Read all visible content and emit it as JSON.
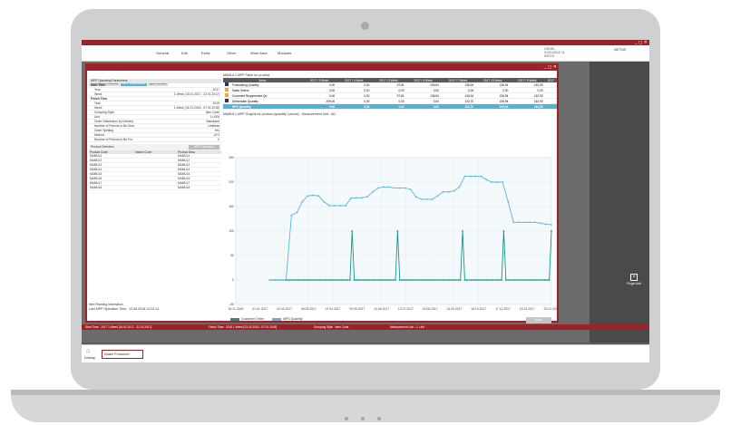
{
  "menu": {
    "items": [
      "General",
      "Edit",
      "Extra",
      "Other",
      "Work Area",
      "Modules"
    ]
  },
  "user": {
    "name": "GENEL",
    "line2": "01/01/2019 11",
    "line3": "INFOS",
    "company": "NETSIS"
  },
  "window": {
    "tabs": [
      "Information Window",
      "MPP Operations",
      "Quit Results"
    ],
    "active_tab": 1
  },
  "params": {
    "title": "MPP Operating Parameters",
    "rows": [
      {
        "k": "Start Time",
        "v": "",
        "sec": true
      },
      {
        "k": "Year",
        "v": "2017"
      },
      {
        "k": "Week",
        "v": "1.Week (16.01.2017 - 22.01.2017)"
      },
      {
        "k": "Finish Time",
        "v": "",
        "sec": true
      },
      {
        "k": "Year",
        "v": "2019"
      },
      {
        "k": "Week",
        "v": "1.Week (31.01.2018 - 07.01.2018)"
      },
      {
        "k": "Grouping Style",
        "v": "Item Code"
      },
      {
        "k": "Unit",
        "v": "1.UOM"
      },
      {
        "k": "Order Distribution by Delivery",
        "v": "Backward"
      },
      {
        "k": "Number of Periods to Be Distr.",
        "v": "Limitless"
      },
      {
        "k": "Order Splitting",
        "v": "Yes"
      },
      {
        "k": "Method",
        "v": "LFO"
      },
      {
        "k": "Number of Periods to Be Fro.",
        "v": "0"
      }
    ]
  },
  "product_selection": {
    "label": "Product Selection",
    "button": "MPP Operating",
    "headers": [
      "Product Code",
      "Variant Code",
      "Product Desc"
    ],
    "rows": [
      [
        "MAMUL1",
        "",
        "MAMUL1"
      ],
      [
        "MAMUL2",
        "",
        "MAMUL2"
      ],
      [
        "MAMUL3",
        "",
        "MAMUL3"
      ],
      [
        "MAMUL4",
        "",
        "MAMUL4"
      ],
      [
        "MAMUL5",
        "",
        "MAMUL5"
      ],
      [
        "MAMUL6",
        "",
        "MAMUL6"
      ],
      [
        "MAMUL7",
        "",
        "MAMUL7"
      ],
      [
        "MAMUL8",
        "",
        "MAMUL8"
      ]
    ]
  },
  "left_footer": {
    "info": "Item Planning Information",
    "last_time": "Last MPP Operation Time : 13.06.2018 14:23:14"
  },
  "table": {
    "title": "MAMUL1 MPP Table for product",
    "headers": [
      "Items",
      "2017 / 3.Week",
      "2017 / 4.Week",
      "2017 / 5.Week",
      "2017 / 6.Week",
      "2017 / 7.Week",
      "2017 / 8.Week",
      "2017 / 9.Week",
      "2017"
    ],
    "rows": [
      {
        "label": "Forecasting Quantity",
        "cb": "c1",
        "vals": [
          "0,00",
          "0,00",
          "97,81",
          "136,94",
          "136,94",
          "136,94",
          "162,90",
          ""
        ]
      },
      {
        "label": "Sales Orders",
        "cb": "c2",
        "vals": [
          "0,00",
          "0,00",
          "0,00",
          "0,00",
          "0,00",
          "0,00",
          "0,00",
          ""
        ]
      },
      {
        "label": "Corrected Requirement Qu",
        "cb": "c2",
        "vals": [
          "0,00",
          "0,00",
          "97,81",
          "136,94",
          "136,94",
          "136,94",
          "162,90",
          ""
        ]
      },
      {
        "label": "Deliverable Quantity",
        "cb": "c1",
        "vals": [
          "299,00",
          "0,00",
          "0,00",
          "0,00",
          "132,70",
          "136,94",
          "162,90",
          ""
        ]
      },
      {
        "label": "MPS Quantity",
        "cb": "c3",
        "vals": [
          "0,00",
          "0,00",
          "0,00",
          "0,00",
          "132,70",
          "136,94",
          "162,90",
          ""
        ],
        "hl": true
      }
    ]
  },
  "chart_title": "MAMUL1 MPP Graphs for product (quantity / period) - Measurement Unit : AD",
  "chart_data": {
    "type": "line",
    "ylim": [
      -50,
      250
    ],
    "yticks": [
      250,
      200,
      150,
      100,
      50,
      0,
      -50
    ],
    "xticks": [
      "30.11.2016",
      "01.01.2017",
      "02.02.2017",
      "06.03.2017",
      "07.04.2017",
      "09.05.2017",
      "10.06.2017",
      "12.07.2017",
      "13.08.2017",
      "14.09.2017",
      "16.10.2017",
      "17.11.2017",
      "19.12.2017",
      "20.01.2018"
    ],
    "series": [
      {
        "name": "Customer Order",
        "color": "#16968a",
        "values": [
          0,
          0,
          0,
          0,
          0,
          0,
          0,
          0,
          0,
          0,
          0,
          0,
          0,
          0,
          0,
          0,
          0,
          0,
          0,
          0,
          0,
          0,
          0,
          0,
          0,
          0,
          0,
          0,
          0,
          0,
          0,
          0,
          0,
          0,
          0,
          0,
          0,
          0,
          100,
          0,
          0,
          0,
          0,
          0,
          0,
          0,
          0,
          0,
          0,
          0,
          0,
          0,
          0,
          0,
          0,
          0,
          0,
          0,
          0,
          100,
          0,
          0,
          0,
          0,
          0,
          0,
          0,
          0,
          0,
          0,
          0,
          0,
          0,
          0,
          0,
          0,
          0,
          0,
          0,
          0,
          0,
          0,
          0,
          0,
          0,
          0,
          0,
          0,
          0,
          100,
          0,
          0,
          0,
          0,
          0,
          0,
          0,
          0,
          0,
          0,
          0,
          0,
          0,
          0,
          0,
          0,
          0,
          0,
          100,
          0,
          0,
          0,
          0,
          0,
          0,
          0,
          0,
          0,
          0,
          0,
          0,
          0,
          0,
          0,
          0,
          0,
          0,
          0,
          0,
          0,
          100
        ]
      },
      {
        "name": "MPS Quantity",
        "color": "#5ab8dc",
        "values": [
          0,
          0,
          0,
          0,
          132,
          138,
          160,
          172,
          173,
          172,
          160,
          152,
          152,
          152,
          152,
          167,
          168,
          168,
          170,
          180,
          188,
          190,
          190,
          188,
          188,
          188,
          185,
          170,
          165,
          165,
          165,
          172,
          180,
          180,
          182,
          190,
          212,
          212,
          212,
          212,
          205,
          200,
          200,
          200,
          160,
          118,
          118,
          118,
          118,
          118,
          116,
          114,
          113
        ]
      }
    ]
  },
  "legend_save": "Save",
  "status": {
    "start": "Start Time : 2017 1.Week [16.01.2017 - 22.01.2017]",
    "finish": "Finish Time : 2018 1.Week [31.01.2018 - 07.01.2018]",
    "group": "Grouping Style : Item Code",
    "unit": "Measurement Unit : 1. Unit"
  },
  "taskbar": {
    "desktop": "Desktop",
    "mp": "Master Production",
    "plugin": "Plugin Add"
  }
}
